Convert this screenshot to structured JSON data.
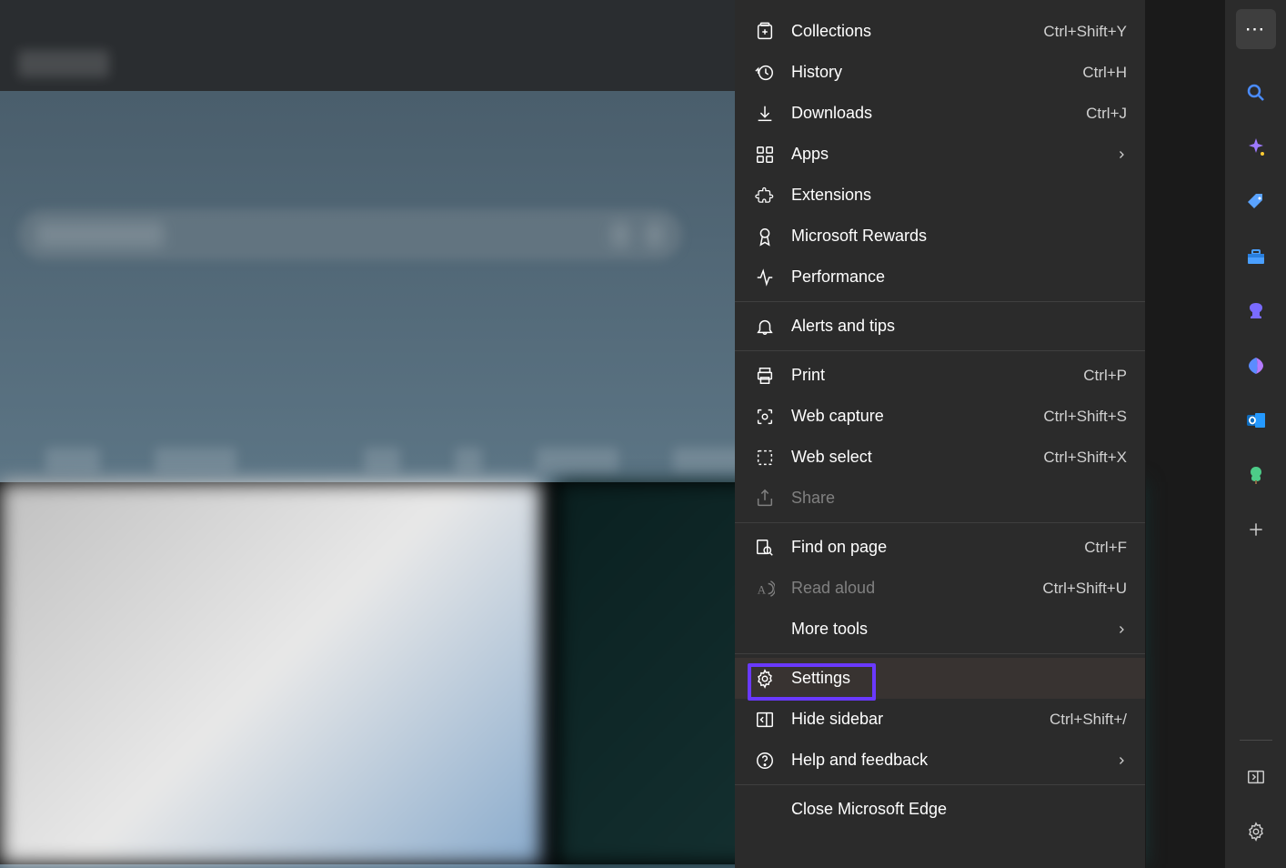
{
  "menu": {
    "items": [
      {
        "label": "Collections",
        "shortcut": "Ctrl+Shift+Y",
        "icon": "collections"
      },
      {
        "label": "History",
        "shortcut": "Ctrl+H",
        "icon": "history"
      },
      {
        "label": "Downloads",
        "shortcut": "Ctrl+J",
        "icon": "downloads"
      },
      {
        "label": "Apps",
        "shortcut": "",
        "icon": "apps",
        "submenu": true
      },
      {
        "label": "Extensions",
        "shortcut": "",
        "icon": "extensions"
      },
      {
        "label": "Microsoft Rewards",
        "shortcut": "",
        "icon": "rewards"
      },
      {
        "label": "Performance",
        "shortcut": "",
        "icon": "performance"
      },
      {
        "label": "Alerts and tips",
        "shortcut": "",
        "icon": "bell"
      },
      {
        "label": "Print",
        "shortcut": "Ctrl+P",
        "icon": "print"
      },
      {
        "label": "Web capture",
        "shortcut": "Ctrl+Shift+S",
        "icon": "capture"
      },
      {
        "label": "Web select",
        "shortcut": "Ctrl+Shift+X",
        "icon": "select"
      },
      {
        "label": "Share",
        "shortcut": "",
        "icon": "share",
        "disabled": true
      },
      {
        "label": "Find on page",
        "shortcut": "Ctrl+F",
        "icon": "find"
      },
      {
        "label": "Read aloud",
        "shortcut": "Ctrl+Shift+U",
        "icon": "readaloud",
        "disabled": true
      },
      {
        "label": "More tools",
        "shortcut": "",
        "icon": "",
        "submenu": true
      },
      {
        "label": "Settings",
        "shortcut": "",
        "icon": "gear",
        "highlight": true,
        "hovered": true
      },
      {
        "label": "Hide sidebar",
        "shortcut": "Ctrl+Shift+/",
        "icon": "hidesidebar"
      },
      {
        "label": "Help and feedback",
        "shortcut": "",
        "icon": "help",
        "submenu": true
      },
      {
        "label": "Close Microsoft Edge",
        "shortcut": "",
        "icon": ""
      }
    ]
  },
  "sidebar": {
    "items": [
      {
        "name": "more",
        "icon": "⋯",
        "active": true
      },
      {
        "name": "search",
        "icon": "search"
      },
      {
        "name": "sparkle",
        "icon": "sparkle"
      },
      {
        "name": "tag",
        "icon": "tag"
      },
      {
        "name": "toolbox",
        "icon": "toolbox"
      },
      {
        "name": "chess",
        "icon": "chess"
      },
      {
        "name": "office",
        "icon": "office"
      },
      {
        "name": "outlook",
        "icon": "outlook"
      },
      {
        "name": "tree",
        "icon": "tree"
      },
      {
        "name": "add",
        "icon": "plus"
      }
    ],
    "bottom": [
      {
        "name": "panel",
        "icon": "panel"
      },
      {
        "name": "settings",
        "icon": "gear"
      }
    ]
  }
}
